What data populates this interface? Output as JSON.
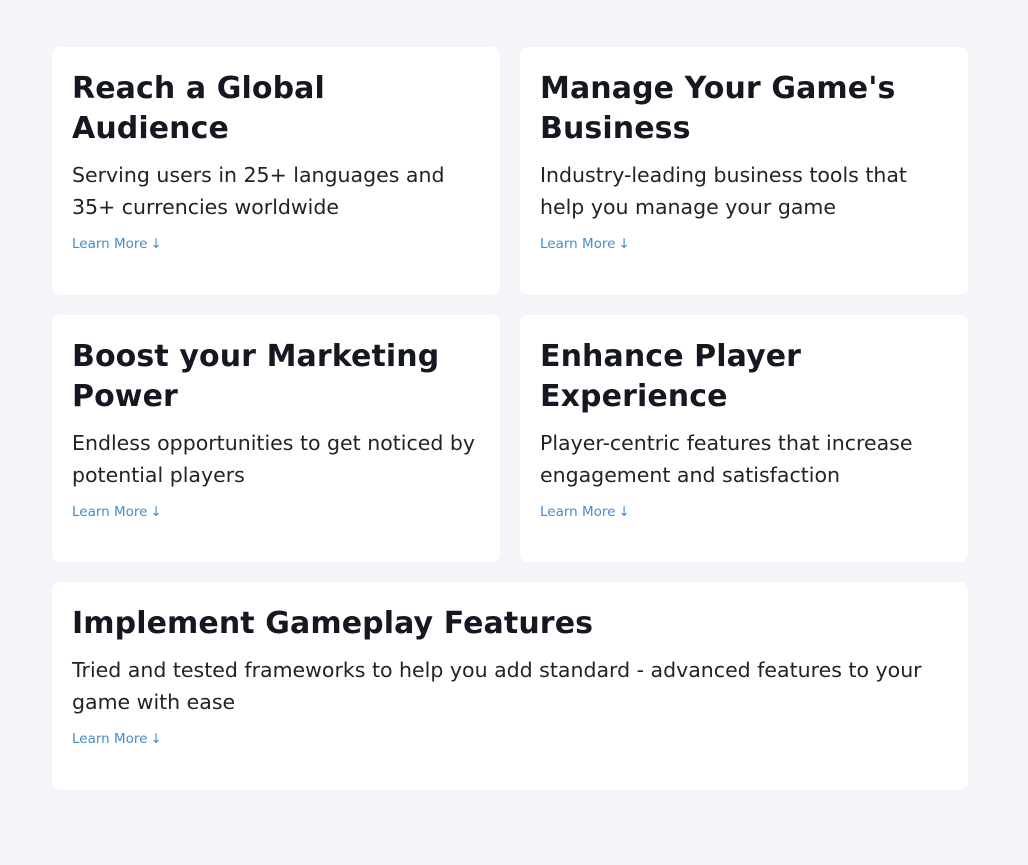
{
  "cards": [
    {
      "title": "Reach a Global Audience",
      "description": "Serving users in 25+ languages and 35+ currencies worldwide",
      "link_label": "Learn More",
      "link_icon": "↓"
    },
    {
      "title": "Manage Your Game's Business",
      "description": "Industry-leading business tools that help you manage your game",
      "link_label": "Learn More",
      "link_icon": "↓"
    },
    {
      "title": "Boost your Marketing Power",
      "description": "Endless opportunities to get noticed by potential players",
      "link_label": "Learn More",
      "link_icon": "↓"
    },
    {
      "title": "Enhance Player Experience",
      "description": "Player-centric features that increase engagement and satisfaction",
      "link_label": "Learn More",
      "link_icon": "↓"
    },
    {
      "title": "Implement Gameplay Features",
      "description": "Tried and tested frameworks to help you add standard - advanced features to your game with ease",
      "link_label": "Learn More",
      "link_icon": "↓"
    }
  ],
  "colors": {
    "page_background": "#f4f5f9",
    "card_background": "#ffffff",
    "heading": "#151820",
    "body_text": "#202329",
    "link": "#4a8cc7"
  },
  "icons": {
    "learn_more": "arrow-down-icon"
  }
}
